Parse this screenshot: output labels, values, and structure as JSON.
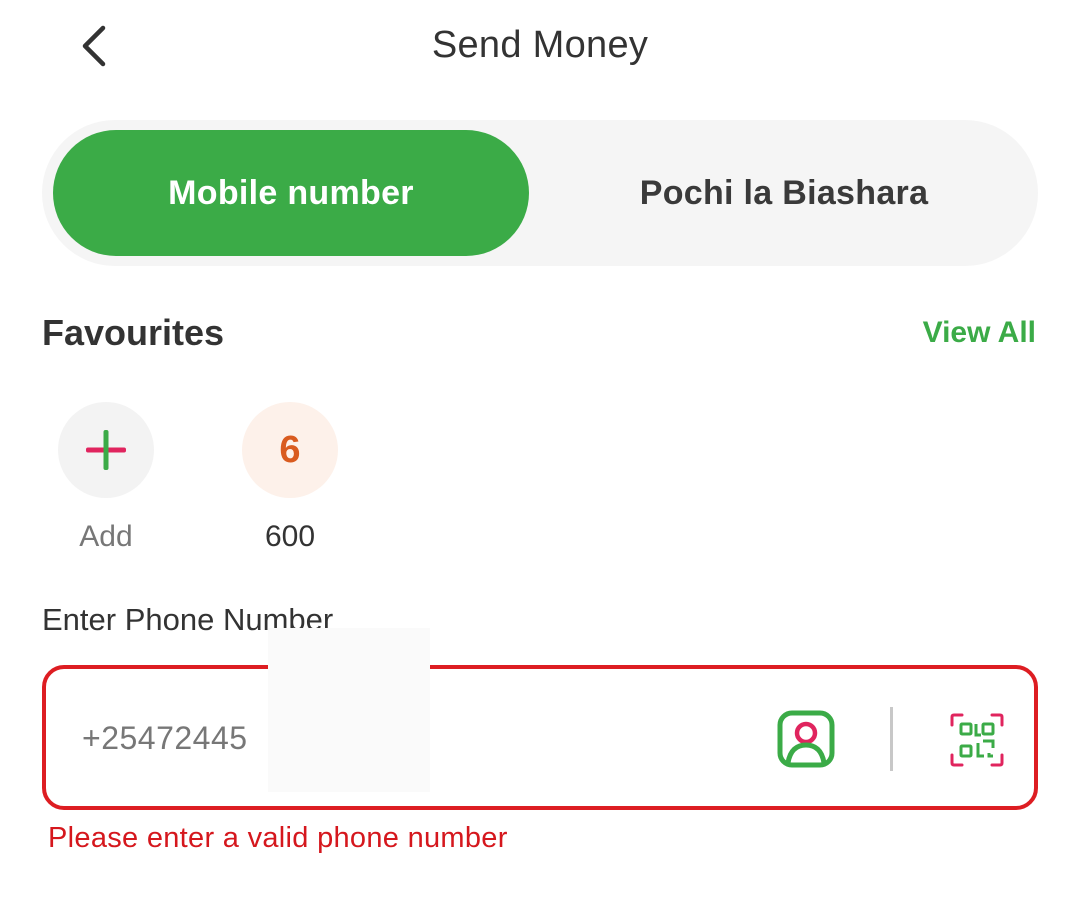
{
  "header": {
    "title": "Send Money",
    "back_icon": "chevron-left-icon"
  },
  "tabs": [
    {
      "label": "Mobile number",
      "active": true
    },
    {
      "label": "Pochi la Biashara",
      "active": false
    }
  ],
  "favourites": {
    "title": "Favourites",
    "view_all": "View All",
    "add": {
      "label": "Add",
      "icon": "plus-icon"
    },
    "items": [
      {
        "initial": "6",
        "label": "600"
      }
    ]
  },
  "phone": {
    "label": "Enter Phone Number",
    "value": "+25472445",
    "error": "Please enter a valid phone number",
    "contact_icon": "contact-book-icon",
    "qr_icon": "qr-scan-icon"
  },
  "colors": {
    "brand_green": "#3bab47",
    "error_red": "#dd1d22",
    "accent_pink": "#e0245e",
    "avatar_orange": "#d95b1f"
  }
}
